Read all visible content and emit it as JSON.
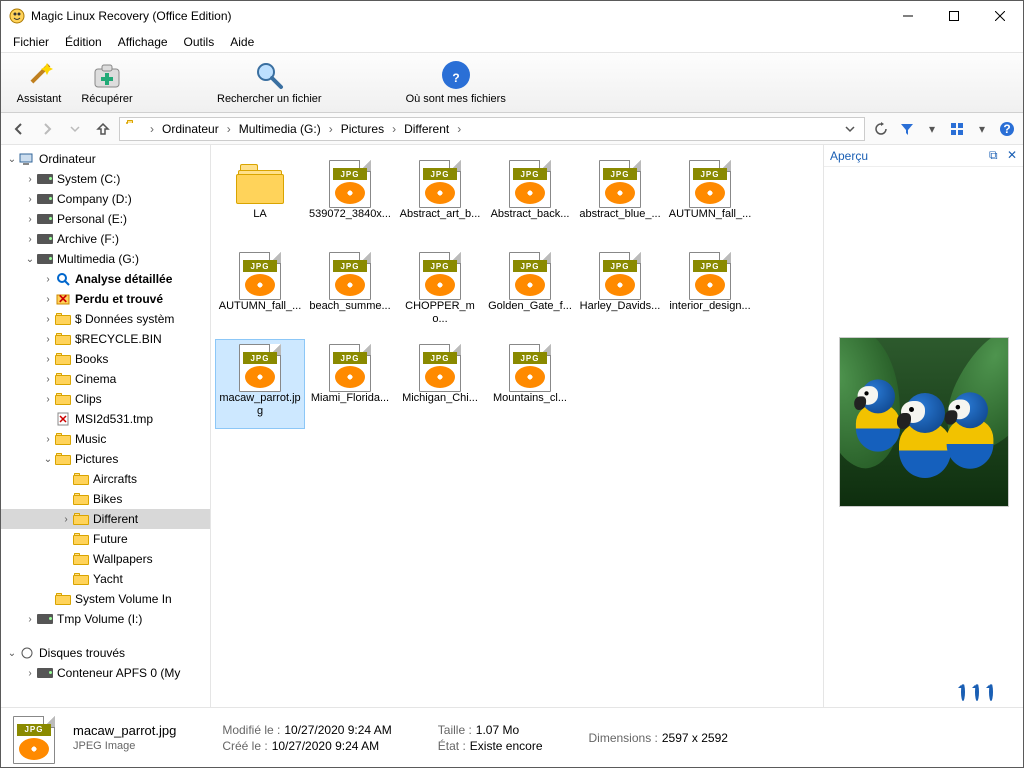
{
  "window": {
    "title": "Magic Linux Recovery (Office Edition)"
  },
  "menu": {
    "items": [
      "Fichier",
      "Édition",
      "Affichage",
      "Outils",
      "Aide"
    ]
  },
  "toolbar": {
    "assistant": "Assistant",
    "recover": "Récupérer",
    "search": "Rechercher un fichier",
    "where": "Où sont mes fichiers"
  },
  "breadcrumbs": {
    "items": [
      "Ordinateur",
      "Multimedia (G:)",
      "Pictures",
      "Different"
    ]
  },
  "tree": {
    "root": "Ordinateur",
    "drives": [
      {
        "label": "System (C:)",
        "icon": "disk"
      },
      {
        "label": "Company (D:)",
        "icon": "disk"
      },
      {
        "label": "Personal (E:)",
        "icon": "disk"
      },
      {
        "label": "Archive (F:)",
        "icon": "disk"
      }
    ],
    "multimedia": "Multimedia (G:)",
    "mm_children": [
      {
        "label": "Analyse détaillée",
        "icon": "scan",
        "bold": true
      },
      {
        "label": "Perdu et trouvé",
        "icon": "lost",
        "bold": true
      },
      {
        "label": "$ Données systèm",
        "icon": "folder"
      },
      {
        "label": "$RECYCLE.BIN",
        "icon": "folder"
      },
      {
        "label": "Books",
        "icon": "folder"
      },
      {
        "label": "Cinema",
        "icon": "folder"
      },
      {
        "label": "Clips",
        "icon": "folder"
      },
      {
        "label": "MSI2d531.tmp",
        "icon": "filex"
      },
      {
        "label": "Music",
        "icon": "folder"
      }
    ],
    "pictures": "Pictures",
    "pic_children": [
      {
        "label": "Aircrafts"
      },
      {
        "label": "Bikes"
      },
      {
        "label": "Different",
        "sel": true
      },
      {
        "label": "Future"
      },
      {
        "label": "Wallpapers"
      },
      {
        "label": "Yacht"
      }
    ],
    "sysvol": "System Volume In",
    "tmpvol": "Tmp Volume (I:)",
    "found_header": "Disques trouvés",
    "found_item": "Conteneur APFS 0 (My"
  },
  "files": [
    {
      "name": "LA",
      "type": "folder"
    },
    {
      "name": "539072_3840x...",
      "type": "jpg"
    },
    {
      "name": "Abstract_art_b...",
      "type": "jpg"
    },
    {
      "name": "Abstract_back...",
      "type": "jpg"
    },
    {
      "name": "abstract_blue_...",
      "type": "jpg"
    },
    {
      "name": "AUTUMN_fall_...",
      "type": "jpg"
    },
    {
      "name": "AUTUMN_fall_...",
      "type": "jpg"
    },
    {
      "name": "beach_summe...",
      "type": "jpg"
    },
    {
      "name": "CHOPPER_mo...",
      "type": "jpg"
    },
    {
      "name": "Golden_Gate_f...",
      "type": "jpg"
    },
    {
      "name": "Harley_Davids...",
      "type": "jpg"
    },
    {
      "name": "interior_design...",
      "type": "jpg"
    },
    {
      "name": "macaw_parrot.jpg",
      "type": "jpg",
      "sel": true
    },
    {
      "name": "Miami_Florida...",
      "type": "jpg"
    },
    {
      "name": "Michigan_Chi...",
      "type": "jpg"
    },
    {
      "name": "Mountains_cl...",
      "type": "jpg"
    }
  ],
  "preview": {
    "title": "Aperçu"
  },
  "status": {
    "name": "macaw_parrot.jpg",
    "type": "JPEG Image",
    "modified_k": "Modifié le :",
    "modified_v": "10/27/2020 9:24 AM",
    "created_k": "Créé le :",
    "created_v": "10/27/2020 9:24 AM",
    "size_k": "Taille :",
    "size_v": "1.07 Mo",
    "state_k": "État :",
    "state_v": "Existe encore",
    "dim_k": "Dimensions :",
    "dim_v": "2597 x 2592"
  }
}
